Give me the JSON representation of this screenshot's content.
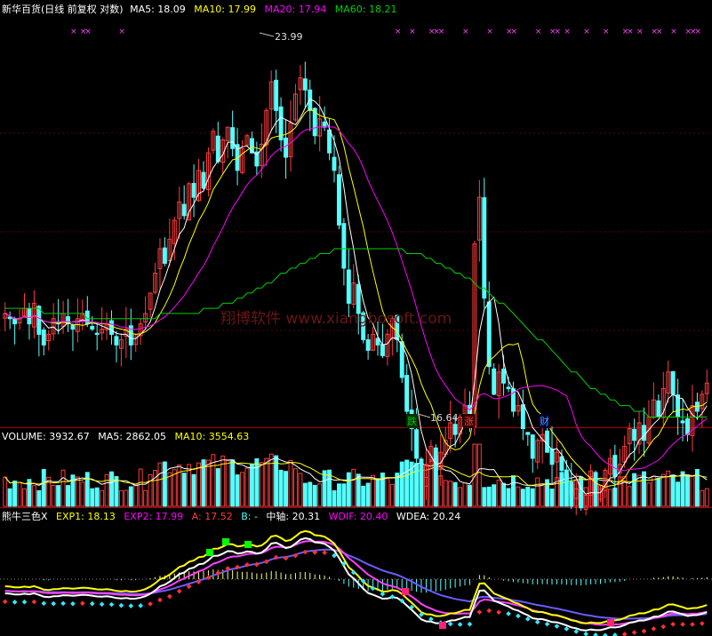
{
  "main_panel": {
    "title": "新华百货(日线 前复权 对数)",
    "ma5": "MA5: 18.09",
    "ma10": "MA10: 17.99",
    "ma20": "MA20: 17.94",
    "ma60": "MA60: 18.21",
    "high_label": "23.99",
    "low_label": "16.64",
    "markers": [
      "跌",
      "涨",
      "财"
    ],
    "watermark": "翔博软件 www.xiangbosoft.com"
  },
  "volume_panel": {
    "volume": "VOLUME: 3932.67",
    "ma5": "MA5: 2862.05",
    "ma10": "MA10: 3554.63"
  },
  "indicator_panel": {
    "name": "熊牛三色X",
    "exp1": "EXP1: 18.13",
    "exp2": "EXP2: 17.99",
    "a": "A: 17.52",
    "b": "B: -",
    "zhongzhou": "中轴: 20.31",
    "wdif": "WDIF: 20.40",
    "wdea": "WDEA: 20.24"
  },
  "colors": {
    "up": "#ff3b3b",
    "down": "#54ffff",
    "ma5": "#ffffff",
    "ma10": "#ffff00",
    "ma20": "#ff00ff",
    "ma60": "#00d000",
    "divider": "#b00000"
  },
  "chart_data": {
    "type": "candlestick",
    "y_scale": "log",
    "ylim": [
      16.0,
      24.8
    ],
    "close": [
      18.0,
      17.9,
      17.8,
      17.9,
      18.1,
      17.8,
      18.2,
      17.6,
      17.4,
      17.6,
      17.9,
      17.8,
      18.0,
      17.8,
      17.7,
      17.9,
      18.0,
      17.8,
      17.7,
      17.6,
      17.7,
      17.8,
      17.6,
      17.4,
      17.5,
      17.7,
      17.4,
      17.6,
      17.8,
      18.0,
      18.4,
      18.8,
      19.3,
      19.0,
      19.5,
      19.9,
      20.3,
      20.0,
      20.7,
      20.4,
      21.0,
      20.6,
      21.4,
      21.9,
      21.2,
      21.7,
      22.0,
      21.5,
      21.0,
      21.5,
      21.8,
      21.4,
      21.1,
      21.6,
      22.4,
      23.1,
      22.4,
      21.7,
      21.3,
      22.1,
      22.8,
      23.2,
      22.9,
      22.4,
      21.8,
      22.2,
      22.0,
      21.4,
      21.0,
      19.8,
      18.9,
      18.2,
      18.6,
      18.0,
      17.5,
      17.3,
      17.6,
      17.4,
      17.2,
      17.6,
      17.9,
      17.5,
      16.8,
      16.2,
      15.9,
      15.4,
      15.0,
      15.3,
      15.6,
      15.2,
      15.5,
      15.7,
      16.0,
      15.8,
      16.1,
      16.3,
      16.0,
      19.4,
      20.4,
      18.3,
      17.0,
      16.5,
      16.9,
      16.7,
      16.6,
      16.2,
      16.3,
      15.9,
      15.8,
      15.4,
      15.7,
      15.8,
      15.5,
      15.3,
      15.5,
      15.2,
      15.0,
      14.8,
      14.9,
      14.6,
      14.8,
      15.1,
      14.8,
      14.9,
      15.2,
      15.4,
      15.1,
      15.3,
      15.6,
      15.9,
      15.7,
      16.0,
      15.7,
      16.1,
      16.4,
      16.1,
      16.6,
      16.9,
      16.5,
      16.1,
      16.0,
      15.8,
      16.3,
      16.2,
      16.5,
      16.7
    ],
    "ma60": [
      18.1,
      18.1,
      18.1,
      18.1,
      18.1,
      18.1,
      18.1,
      18.1,
      18.0,
      18.0,
      18.0,
      18.0,
      18.0,
      18.0,
      18.0,
      18.0,
      18.0,
      17.9,
      17.9,
      17.9,
      17.9,
      17.9,
      17.9,
      17.9,
      17.9,
      17.9,
      17.9,
      17.9,
      17.9,
      17.9,
      17.9,
      17.9,
      18.0,
      18.0,
      18.0,
      18.0,
      18.0,
      18.0,
      18.0,
      18.0,
      18.0,
      18.1,
      18.1,
      18.1,
      18.1,
      18.2,
      18.2,
      18.2,
      18.3,
      18.3,
      18.4,
      18.4,
      18.5,
      18.5,
      18.6,
      18.6,
      18.7,
      18.8,
      18.8,
      18.9,
      18.9,
      19.0,
      19.0,
      19.1,
      19.1,
      19.2,
      19.2,
      19.2,
      19.3,
      19.3,
      19.3,
      19.3,
      19.3,
      19.3,
      19.3,
      19.3,
      19.3,
      19.3,
      19.3,
      19.3,
      19.3,
      19.3,
      19.3,
      19.2,
      19.2,
      19.2,
      19.2,
      19.1,
      19.1,
      19.0,
      19.0,
      18.9,
      18.9,
      18.8,
      18.8,
      18.7,
      18.7,
      18.6,
      18.5,
      18.5,
      18.4,
      18.3,
      18.2,
      18.2,
      18.1,
      18.0,
      17.9,
      17.8,
      17.7,
      17.6,
      17.5,
      17.5,
      17.4,
      17.3,
      17.2,
      17.1,
      17.0,
      16.9,
      16.9,
      16.8,
      16.7,
      16.6,
      16.6,
      16.5,
      16.5,
      16.4,
      16.4,
      16.3,
      16.3,
      16.3,
      16.2,
      16.2,
      16.2,
      16.1,
      16.1,
      16.1,
      16.1,
      16.1,
      16.1,
      16.1,
      16.1,
      16.1,
      16.1,
      16.1,
      16.1,
      16.1
    ],
    "series": [
      {
        "name": "MA5"
      },
      {
        "name": "MA10"
      },
      {
        "name": "MA20"
      },
      {
        "name": "MA60"
      }
    ]
  }
}
